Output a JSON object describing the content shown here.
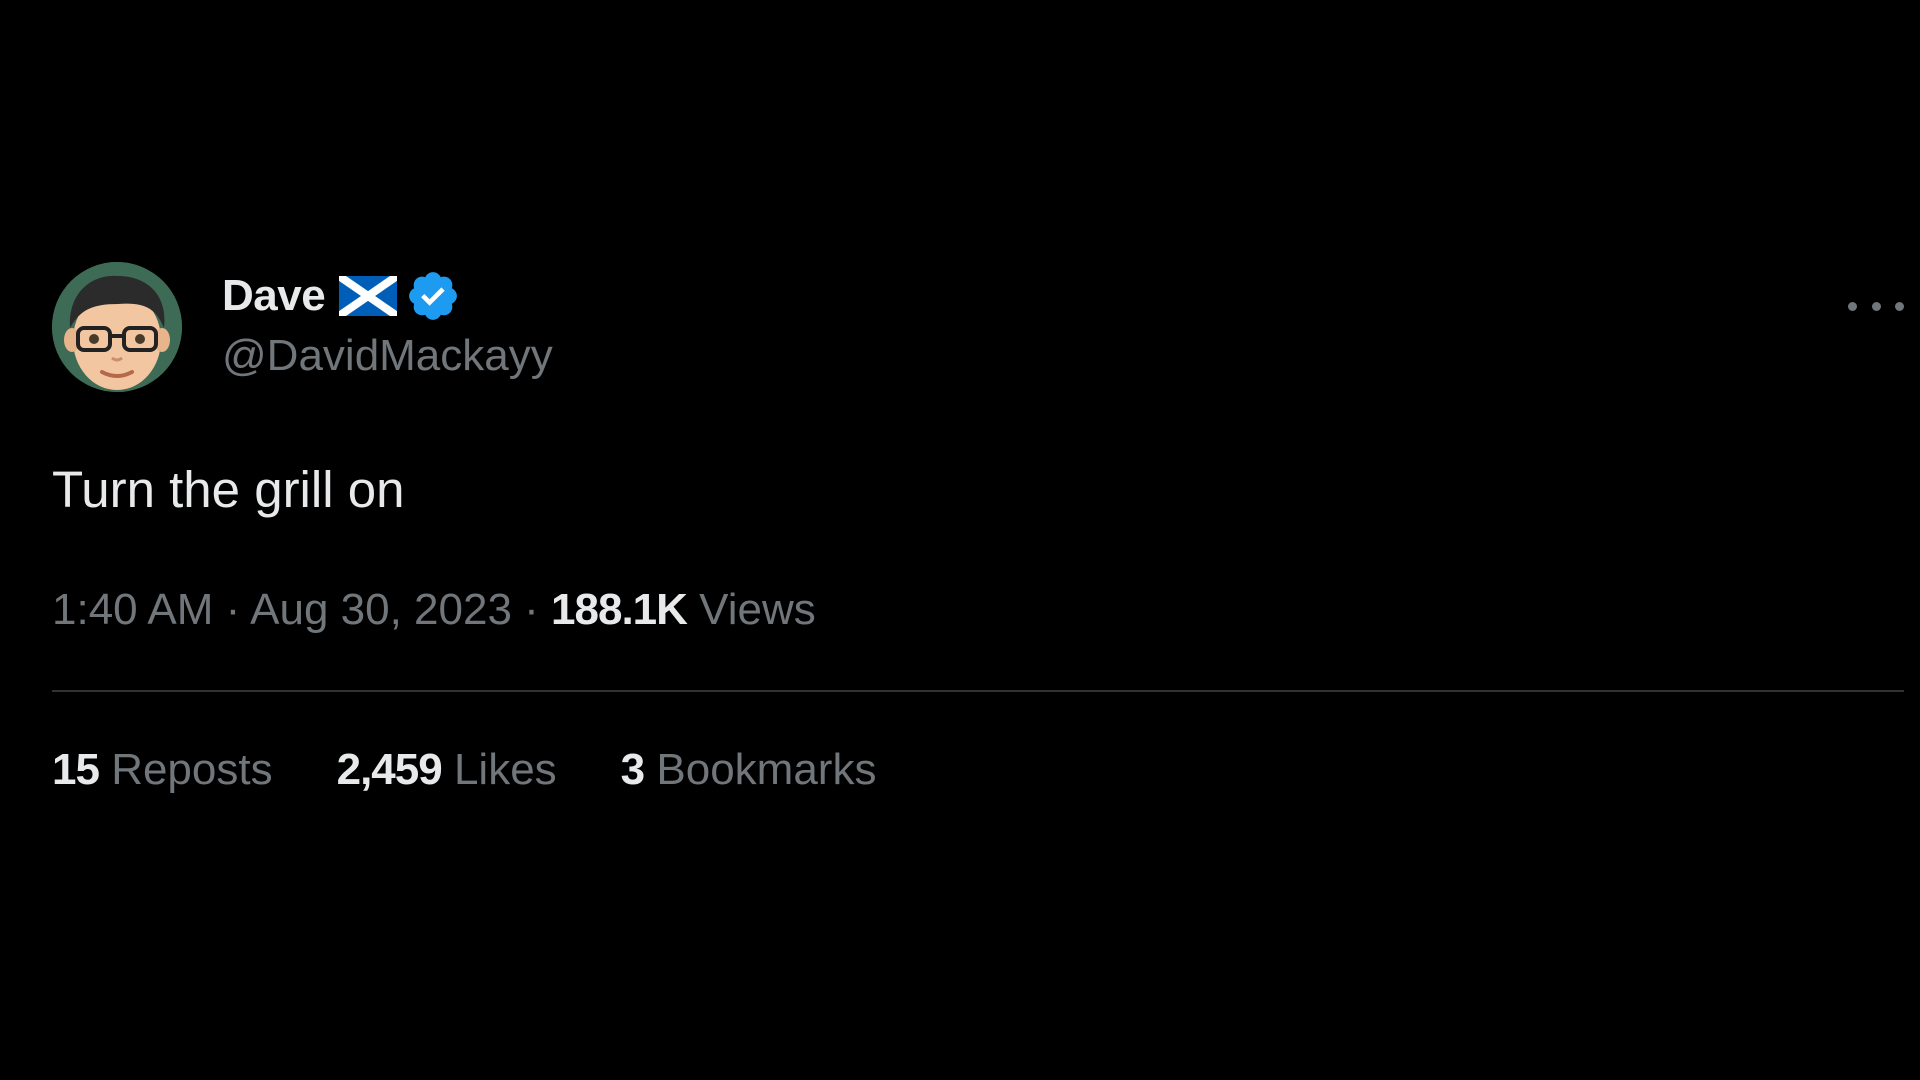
{
  "tweet": {
    "author": {
      "display_name": "Dave",
      "handle": "@DavidMackayy",
      "flag_icon": "scotland-flag-icon",
      "verified_icon": "verified-badge-icon"
    },
    "text": "Turn the grill on",
    "time": "1:40 AM",
    "date": "Aug 30, 2023",
    "separator": "·",
    "views_count": "188.1K",
    "views_label": "Views",
    "stats": {
      "reposts_count": "15",
      "reposts_label": "Reposts",
      "likes_count": "2,459",
      "likes_label": "Likes",
      "bookmarks_count": "3",
      "bookmarks_label": "Bookmarks"
    }
  },
  "colors": {
    "background": "#000000",
    "primary_text": "#e7e9ea",
    "secondary_text": "#71767b",
    "divider": "#2f3336",
    "verified_blue": "#1d9bf0",
    "flag_blue": "#005eb8"
  }
}
